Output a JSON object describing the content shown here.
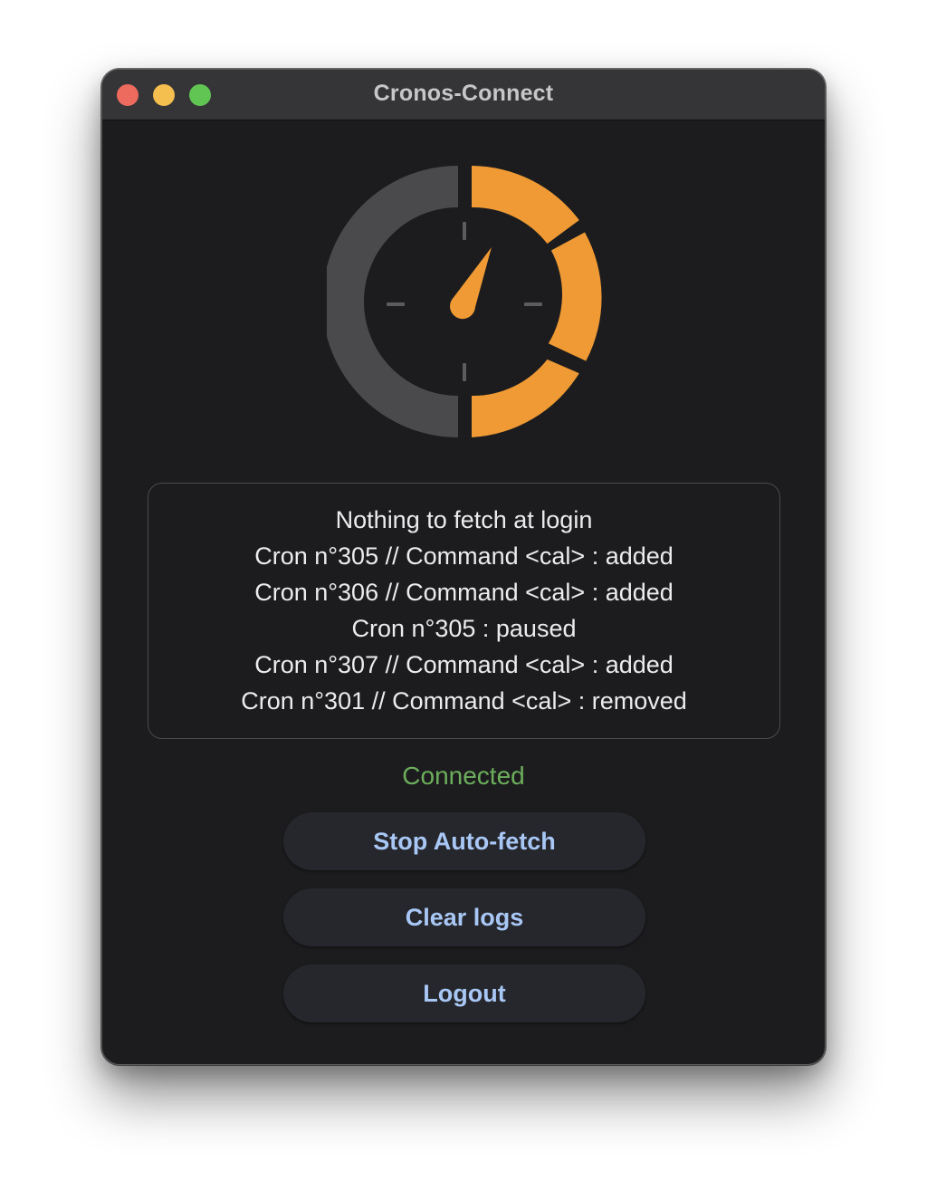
{
  "window": {
    "title": "Cronos-Connect"
  },
  "colors": {
    "close": "#ec6a5e",
    "minimize": "#f4bf4f",
    "maximize": "#61c554",
    "accent": "#ef9a34",
    "gauge_track": "#4a4a4c",
    "status_connected": "#6cae5c",
    "button_text": "#a9c7f5"
  },
  "logo": {
    "icon": "stopwatch-gauge-icon"
  },
  "logs": {
    "lines": [
      "Nothing to fetch at login",
      "Cron n°305 // Command <cal> : added",
      "Cron n°306 // Command <cal> : added",
      "Cron n°305 : paused",
      "Cron n°307 // Command <cal> : added",
      "Cron n°301 // Command <cal> : removed"
    ]
  },
  "status": {
    "text": "Connected"
  },
  "buttons": {
    "stop_autofetch": "Stop Auto-fetch",
    "clear_logs": "Clear logs",
    "logout": "Logout"
  }
}
